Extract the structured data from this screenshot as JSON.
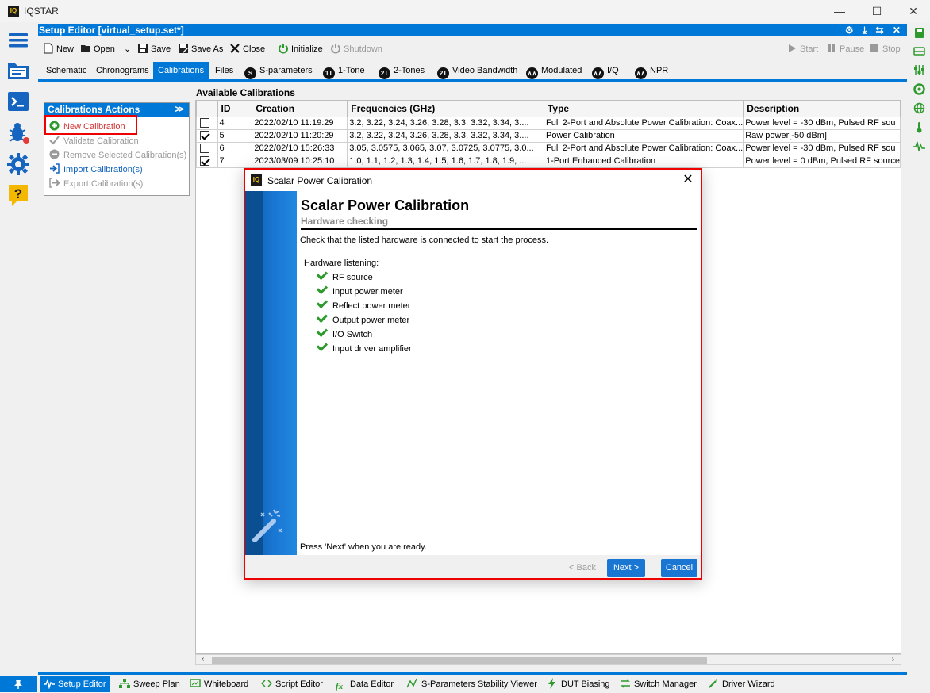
{
  "app": {
    "title": "IQSTAR",
    "logo_text": "IQ"
  },
  "window_controls": {
    "minimize": "—",
    "maximize": "☐",
    "close": "✕"
  },
  "editor": {
    "title": "Setup Editor [virtual_setup.set*]",
    "header_icons": "⚙ ⤓ ⇆ ✕"
  },
  "toolbar": {
    "new": "New",
    "open": "Open",
    "save": "Save",
    "save_as": "Save As",
    "close": "Close",
    "initialize": "Initialize",
    "shutdown": "Shutdown",
    "start": "Start",
    "pause": "Pause",
    "stop": "Stop"
  },
  "tabs": [
    {
      "label": "Schematic"
    },
    {
      "label": "Chronograms"
    },
    {
      "label": "Calibrations",
      "active": true
    },
    {
      "label": "Files"
    },
    {
      "label": "S-parameters",
      "badge": "S"
    },
    {
      "label": "1-Tone",
      "badge": "1T"
    },
    {
      "label": "2-Tones",
      "badge": "2T"
    },
    {
      "label": "Video Bandwidth",
      "badge": "2T"
    },
    {
      "label": "Modulated",
      "badge": "∧∧"
    },
    {
      "label": "I/Q",
      "badge": "∧∧"
    },
    {
      "label": "NPR",
      "badge": "∧∧"
    }
  ],
  "actions_panel": {
    "title": "Calibrations Actions",
    "collapse_glyph": "≫",
    "items": [
      {
        "label": "New Calibration",
        "state": "highlighted"
      },
      {
        "label": "Validate Calibration",
        "state": "disabled"
      },
      {
        "label": "Remove Selected Calibration(s)",
        "state": "disabled"
      },
      {
        "label": "Import Calibration(s)",
        "state": "enabled"
      },
      {
        "label": "Export Calibration(s)",
        "state": "disabled"
      }
    ]
  },
  "calibrations": {
    "section_title": "Available Calibrations",
    "columns": [
      "",
      "ID",
      "Creation",
      "Frequencies (GHz)",
      "Type",
      "Description"
    ],
    "rows": [
      {
        "checked": false,
        "id": "4",
        "creation": "2022/02/10 11:19:29",
        "frequencies": "3.2, 3.22, 3.24, 3.26, 3.28, 3.3, 3.32, 3.34, 3....",
        "type": "Full 2-Port and Absolute Power Calibration: Coax...",
        "description": "Power level = -30 dBm, Pulsed RF sou"
      },
      {
        "checked": true,
        "id": "5",
        "creation": "2022/02/10 11:20:29",
        "frequencies": "3.2, 3.22, 3.24, 3.26, 3.28, 3.3, 3.32, 3.34, 3....",
        "type": "Power Calibration",
        "description": "Raw power[-50 dBm]"
      },
      {
        "checked": false,
        "id": "6",
        "creation": "2022/02/10 15:26:33",
        "frequencies": "3.05, 3.0575, 3.065, 3.07, 3.0725, 3.0775, 3.0...",
        "type": "Full 2-Port and Absolute Power Calibration: Coax...",
        "description": "Power level = -30 dBm, Pulsed RF sou"
      },
      {
        "checked": true,
        "id": "7",
        "creation": "2023/03/09 10:25:10",
        "frequencies": "1.0, 1.1, 1.2, 1.3, 1.4, 1.5, 1.6, 1.7, 1.8, 1.9, ...",
        "type": "1-Port Enhanced Calibration",
        "description": "Power level = 0 dBm, Pulsed RF source"
      }
    ]
  },
  "scroll": {
    "left": "‹",
    "right": "›"
  },
  "dialog": {
    "window_title": "Scalar Power Calibration",
    "heading": "Scalar Power Calibration",
    "subheading": "Hardware checking",
    "instruction": "Check that the listed hardware is connected to start the process.",
    "hardware_title": "Hardware listening:",
    "hardware": [
      "RF source",
      "Input power meter",
      "Reflect power meter",
      "Output power meter",
      "I/O Switch",
      "Input driver amplifier"
    ],
    "ready_text": "Press 'Next' when you are ready.",
    "back_label": "< Back",
    "next_label": "Next >",
    "cancel_label": "Cancel",
    "close_glyph": "✕"
  },
  "bottom_tabs": [
    {
      "label": "Setup Editor",
      "active": true
    },
    {
      "label": "Sweep Plan"
    },
    {
      "label": "Whiteboard"
    },
    {
      "label": "Script Editor"
    },
    {
      "label": "Data Editor"
    },
    {
      "label": "S-Parameters Stability Viewer"
    },
    {
      "label": "DUT Biasing"
    },
    {
      "label": "Switch Manager"
    },
    {
      "label": "Driver Wizard"
    }
  ],
  "colors": {
    "accent": "#0078d7",
    "highlight_red": "#ee0000",
    "check_green": "#2e9a2e"
  }
}
